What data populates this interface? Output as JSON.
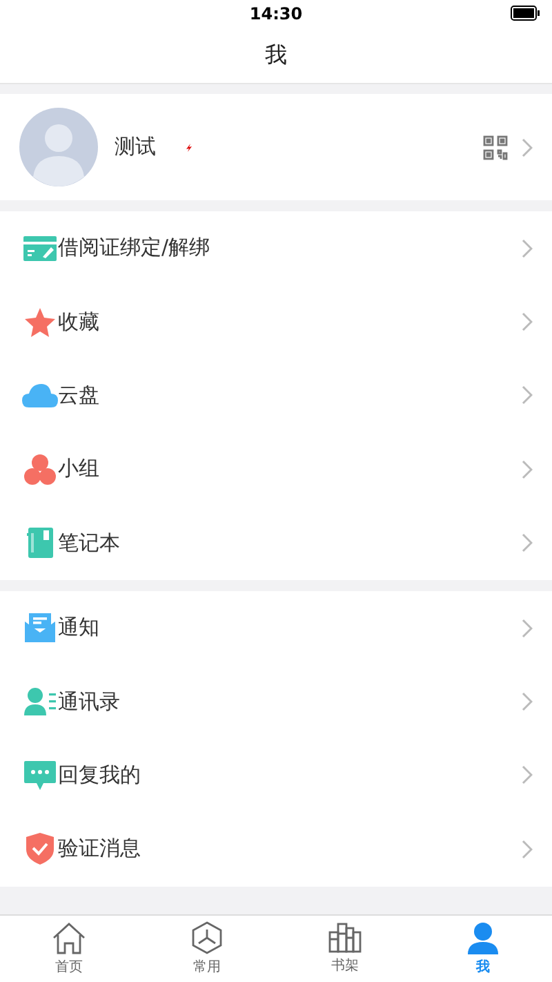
{
  "status_bar": {
    "time": "14:30"
  },
  "title": "我",
  "profile": {
    "name": "测试"
  },
  "groups": [
    {
      "items": [
        {
          "label": "借阅证绑定/解绑"
        },
        {
          "label": "收藏"
        },
        {
          "label": "云盘"
        },
        {
          "label": "小组"
        },
        {
          "label": "笔记本"
        }
      ]
    },
    {
      "items": [
        {
          "label": "通知"
        },
        {
          "label": "通讯录"
        },
        {
          "label": "回复我的"
        },
        {
          "label": "验证消息"
        }
      ]
    }
  ],
  "tabs": [
    {
      "label": "首页",
      "selected": false
    },
    {
      "label": "常用",
      "selected": false
    },
    {
      "label": "书架",
      "selected": false
    },
    {
      "label": "我",
      "selected": true
    }
  ]
}
